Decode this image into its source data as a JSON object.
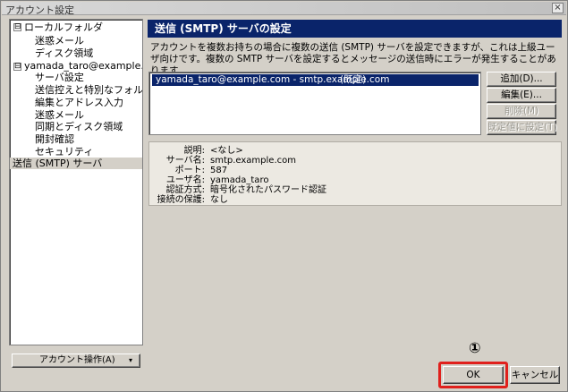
{
  "window": {
    "title": "アカウント設定",
    "close_glyph": "×"
  },
  "tree": {
    "items": [
      {
        "label": "ローカルフォルダ",
        "expander": "⊟"
      },
      {
        "label": "迷惑メール"
      },
      {
        "label": "ディスク領域"
      },
      {
        "label": "yamada_taro@example.com",
        "expander": "⊟"
      },
      {
        "label": "サーバ設定"
      },
      {
        "label": "送信控えと特別なフォルダ"
      },
      {
        "label": "編集とアドレス入力"
      },
      {
        "label": "迷惑メール"
      },
      {
        "label": "同期とディスク領域"
      },
      {
        "label": "開封確認"
      },
      {
        "label": "セキュリティ"
      },
      {
        "label": "送信 (SMTP) サーバ"
      }
    ],
    "account_button": {
      "label": "アカウント操作(A)",
      "arrow": "▾"
    }
  },
  "panel": {
    "header": "送信 (SMTP) サーバの設定",
    "description": "アカウントを複数お持ちの場合に複数の送信 (SMTP) サーバを設定できますが、これは上級ユーザ向けです。複数の SMTP サーバを設定するとメッセージの送信時にエラーが発生することがあります。",
    "server_row": {
      "account": "yamada_taro@example.com - smtp.example.com",
      "default_label": "(既定)"
    },
    "buttons": {
      "add": "追加(D)...",
      "edit": "編集(E)...",
      "delete": "削除(M)",
      "set_default": "既定値に設定(T)"
    },
    "details": [
      {
        "key": "説明:",
        "value": "<なし>"
      },
      {
        "key": "サーバ名:",
        "value": "smtp.example.com"
      },
      {
        "key": "ポート:",
        "value": "587"
      },
      {
        "key": "ユーザ名:",
        "value": "yamada_taro"
      },
      {
        "key": "認証方式:",
        "value": "暗号化されたパスワード認証"
      },
      {
        "key": "接続の保護:",
        "value": "なし"
      }
    ]
  },
  "footer": {
    "marker": "①",
    "ok": "OK",
    "cancel": "キャンセル"
  },
  "colors": {
    "header_bg": "#0a246a",
    "highlight_red": "#e0201c",
    "dialog_bg": "#d4d0c8"
  }
}
